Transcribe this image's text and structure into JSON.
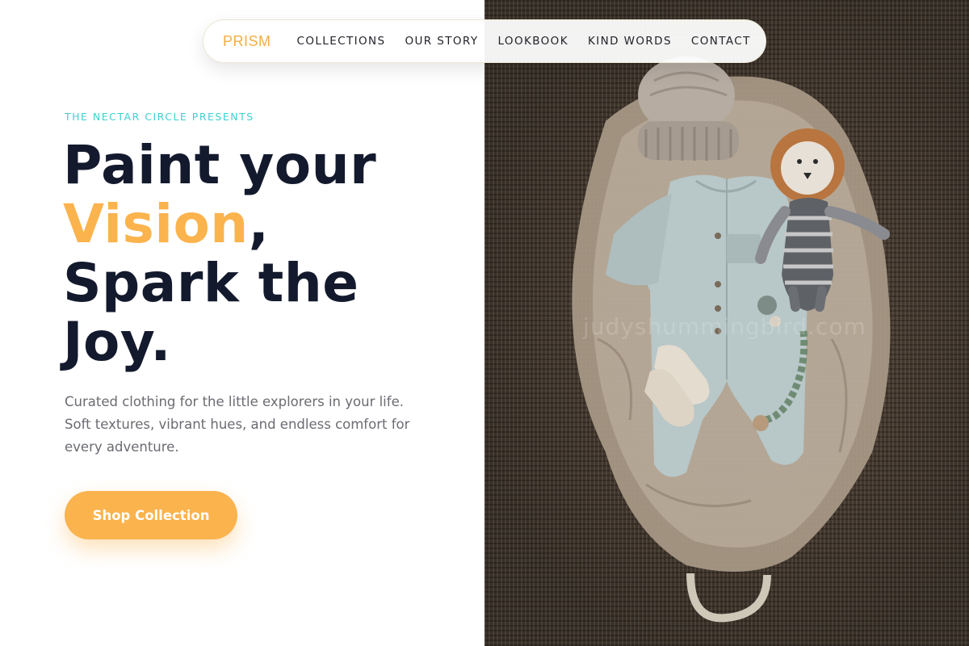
{
  "nav": {
    "brand": "PRISM",
    "links": [
      "COLLECTIONS",
      "OUR STORY",
      "LOOKBOOK",
      "KIND WORDS",
      "CONTACT"
    ]
  },
  "hero": {
    "eyebrow": "THE NECTAR CIRCLE PRESENTS",
    "headline_line1": "Paint your",
    "headline_accent": "Vision",
    "headline_comma": ",",
    "headline_line3": "Spark the",
    "headline_line4": "Joy.",
    "subtext": "Curated clothing for the little explorers in your life. Soft textures, vibrant hues, and endless comfort for every adventure.",
    "cta_label": "Shop Collection"
  },
  "photo": {
    "watermark": "judyshummingbird.com",
    "description_icons": [
      "knit-hat",
      "baby-romper",
      "lion-plush-toy",
      "socks",
      "pacifier-clip",
      "muslin-blanket",
      "woven-rug"
    ]
  },
  "colors": {
    "accent": "#fbb34d",
    "brand": "#f6ad42",
    "eyebrow": "#3fd0d2",
    "heading": "#141a2d",
    "body_text": "#6b6b72"
  }
}
